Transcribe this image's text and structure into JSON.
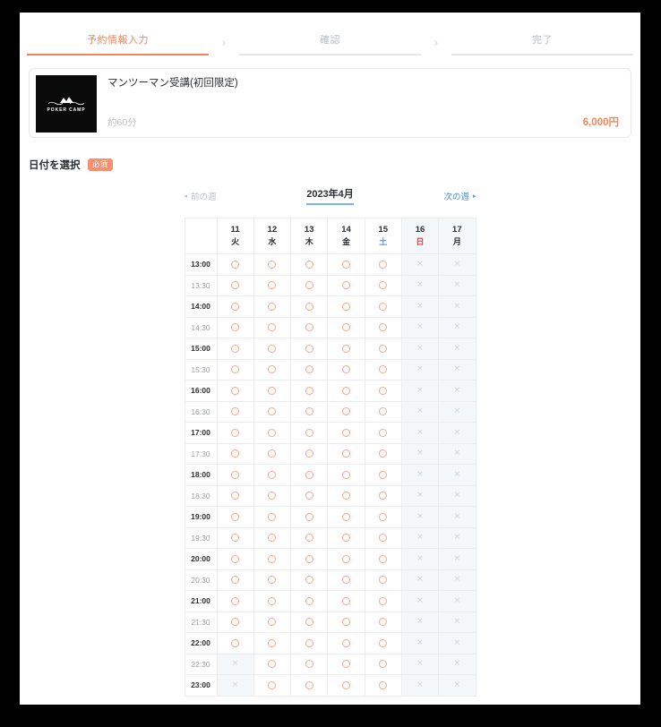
{
  "steps": {
    "separator": "›",
    "items": [
      {
        "label": "予約情報入力",
        "state": "active"
      },
      {
        "label": "確認",
        "state": "inactive"
      },
      {
        "label": "完了",
        "state": "inactive"
      }
    ]
  },
  "card": {
    "title": "マンツーマン受講(初回限定)",
    "duration": "約60分",
    "price": "6,000円",
    "logo_text": "POKER CAMP",
    "accent_color": "#f5845c"
  },
  "section": {
    "title": "日付を選択",
    "required_badge": "必須"
  },
  "week_nav": {
    "prev_label": "前の週",
    "prev_arrow": "◂",
    "next_label": "次の週",
    "next_arrow": "▸",
    "month_label": "2023年4月",
    "prev_color": "#b9bec3",
    "next_color": "#4a90d9"
  },
  "calendar": {
    "days": [
      {
        "num": "11",
        "name": "火",
        "kind": "weekday",
        "dim": false
      },
      {
        "num": "12",
        "name": "水",
        "kind": "weekday",
        "dim": false
      },
      {
        "num": "13",
        "name": "木",
        "kind": "weekday",
        "dim": false
      },
      {
        "num": "14",
        "name": "金",
        "kind": "weekday",
        "dim": false
      },
      {
        "num": "15",
        "name": "土",
        "kind": "sat",
        "dim": false
      },
      {
        "num": "16",
        "name": "日",
        "kind": "sun",
        "dim": true
      },
      {
        "num": "17",
        "name": "月",
        "kind": "weekday",
        "dim": true
      }
    ],
    "mark_available": "○",
    "mark_unavailable": "×",
    "available_color": "#f7a68c",
    "unavailable_color": "#cbd2d8",
    "rows": [
      {
        "time": "13:00",
        "hour": true,
        "slots": [
          "o",
          "o",
          "o",
          "o",
          "o",
          "x",
          "x"
        ]
      },
      {
        "time": "13:30",
        "hour": false,
        "slots": [
          "o",
          "o",
          "o",
          "o",
          "o",
          "x",
          "x"
        ]
      },
      {
        "time": "14:00",
        "hour": true,
        "slots": [
          "o",
          "o",
          "o",
          "o",
          "o",
          "x",
          "x"
        ]
      },
      {
        "time": "14:30",
        "hour": false,
        "slots": [
          "o",
          "o",
          "o",
          "o",
          "o",
          "x",
          "x"
        ]
      },
      {
        "time": "15:00",
        "hour": true,
        "slots": [
          "o",
          "o",
          "o",
          "o",
          "o",
          "x",
          "x"
        ]
      },
      {
        "time": "15:30",
        "hour": false,
        "slots": [
          "o",
          "o",
          "o",
          "o",
          "o",
          "x",
          "x"
        ]
      },
      {
        "time": "16:00",
        "hour": true,
        "slots": [
          "o",
          "o",
          "o",
          "o",
          "o",
          "x",
          "x"
        ]
      },
      {
        "time": "16:30",
        "hour": false,
        "slots": [
          "o",
          "o",
          "o",
          "o",
          "o",
          "x",
          "x"
        ]
      },
      {
        "time": "17:00",
        "hour": true,
        "slots": [
          "o",
          "o",
          "o",
          "o",
          "o",
          "x",
          "x"
        ]
      },
      {
        "time": "17:30",
        "hour": false,
        "slots": [
          "o",
          "o",
          "o",
          "o",
          "o",
          "x",
          "x"
        ]
      },
      {
        "time": "18:00",
        "hour": true,
        "slots": [
          "o",
          "o",
          "o",
          "o",
          "o",
          "x",
          "x"
        ]
      },
      {
        "time": "18:30",
        "hour": false,
        "slots": [
          "o",
          "o",
          "o",
          "o",
          "o",
          "x",
          "x"
        ]
      },
      {
        "time": "19:00",
        "hour": true,
        "slots": [
          "o",
          "o",
          "o",
          "o",
          "o",
          "x",
          "x"
        ]
      },
      {
        "time": "19:30",
        "hour": false,
        "slots": [
          "o",
          "o",
          "o",
          "o",
          "o",
          "x",
          "x"
        ]
      },
      {
        "time": "20:00",
        "hour": true,
        "slots": [
          "o",
          "o",
          "o",
          "o",
          "o",
          "x",
          "x"
        ]
      },
      {
        "time": "20:30",
        "hour": false,
        "slots": [
          "o",
          "o",
          "o",
          "o",
          "o",
          "x",
          "x"
        ]
      },
      {
        "time": "21:00",
        "hour": true,
        "slots": [
          "o",
          "o",
          "o",
          "o",
          "o",
          "x",
          "x"
        ]
      },
      {
        "time": "21:30",
        "hour": false,
        "slots": [
          "o",
          "o",
          "o",
          "o",
          "o",
          "x",
          "x"
        ]
      },
      {
        "time": "22:00",
        "hour": true,
        "slots": [
          "o",
          "o",
          "o",
          "o",
          "o",
          "x",
          "x"
        ]
      },
      {
        "time": "22:30",
        "hour": false,
        "slots": [
          "x",
          "o",
          "o",
          "o",
          "o",
          "x",
          "x"
        ]
      },
      {
        "time": "23:00",
        "hour": true,
        "slots": [
          "x",
          "o",
          "o",
          "o",
          "o",
          "x",
          "x"
        ]
      }
    ]
  }
}
